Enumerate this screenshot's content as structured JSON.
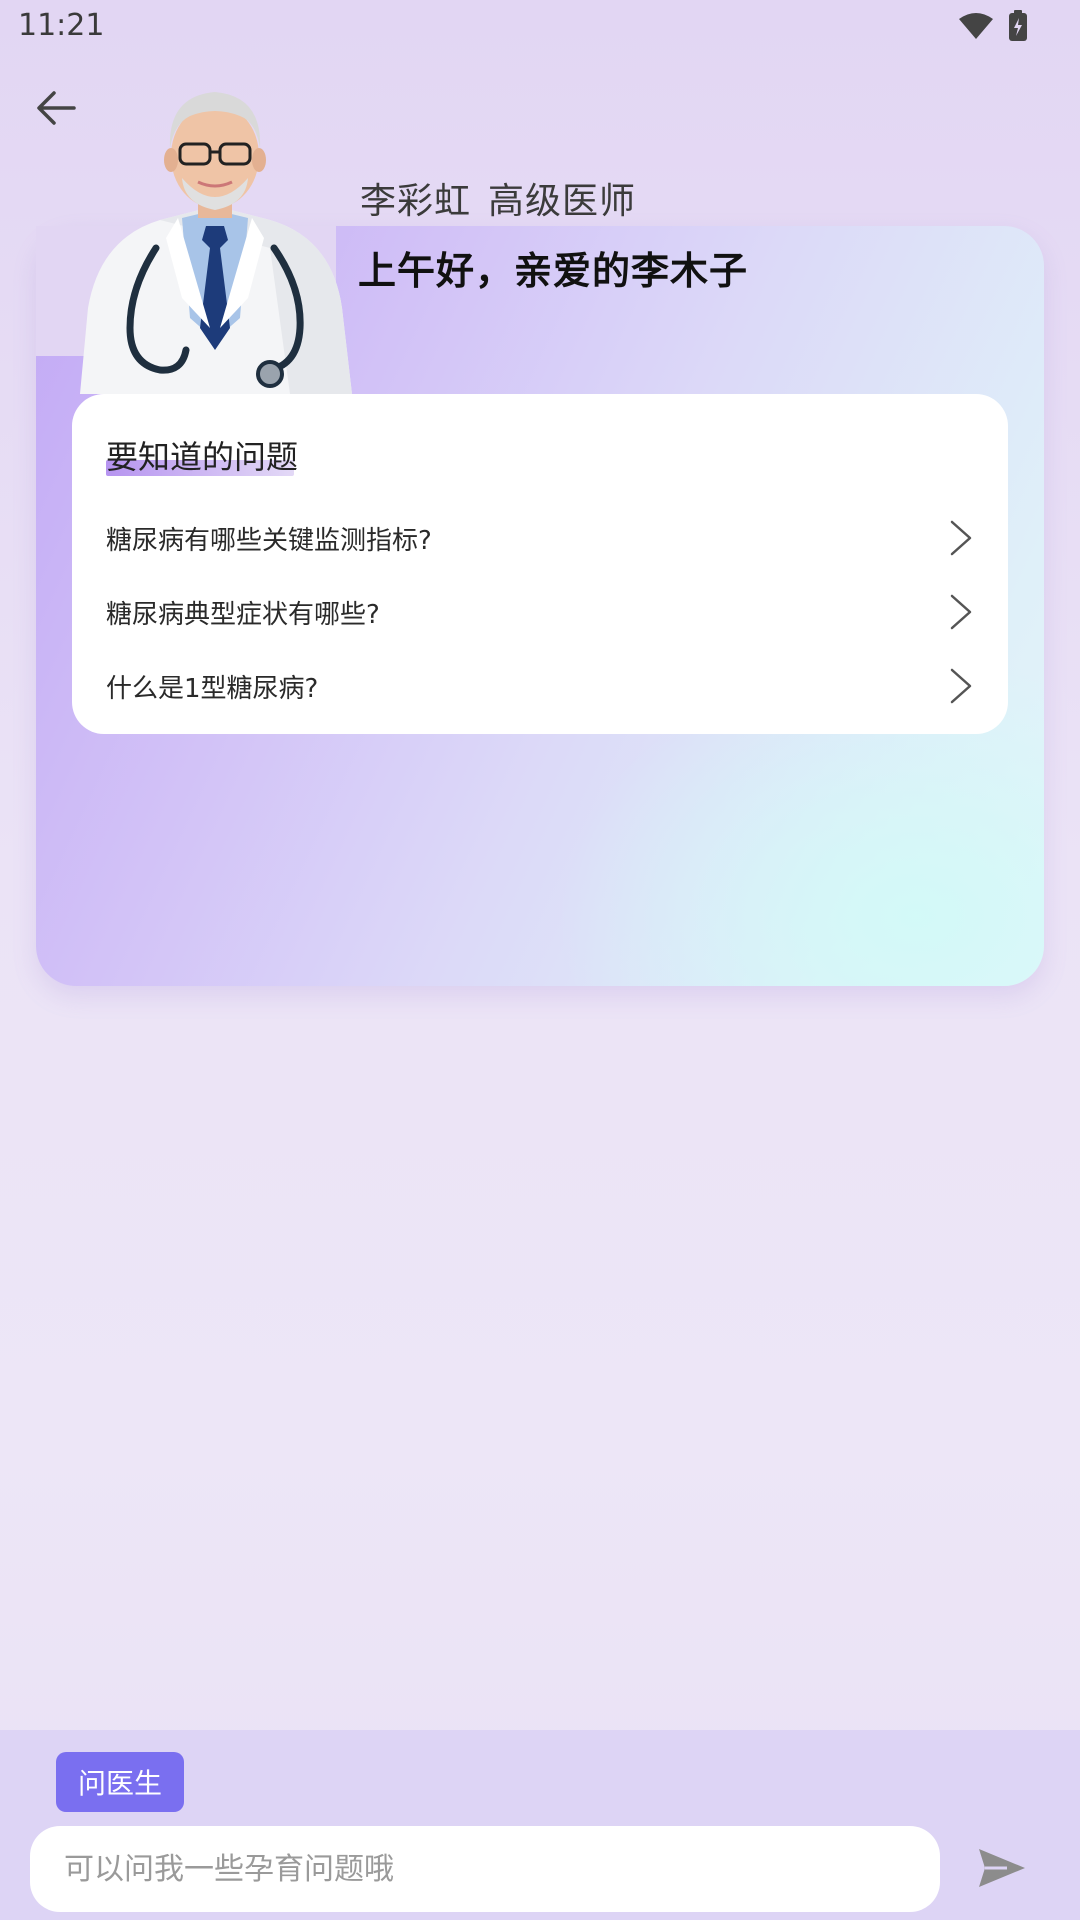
{
  "status_bar": {
    "time": "11:21"
  },
  "doctor": {
    "name": "李彩虹",
    "title": "高级医师",
    "greeting": "上午好，亲爱的李木子"
  },
  "questions_panel": {
    "title": "要知道的问题",
    "items": [
      {
        "label": "糖尿病有哪些关键监测指标?"
      },
      {
        "label": "糖尿病典型症状有哪些?"
      },
      {
        "label": "什么是1型糖尿病?"
      }
    ]
  },
  "bottom": {
    "tag_label": "问医生",
    "input_placeholder": "可以问我一些孕育问题哦",
    "input_value": ""
  },
  "colors": {
    "accent": "#7a6ff0",
    "card_start": "#c2a9f5",
    "card_end": "#e3f5fa"
  },
  "icons": [
    "wifi-icon",
    "battery-icon",
    "back-arrow-icon",
    "chevron-right-icon",
    "send-icon"
  ]
}
